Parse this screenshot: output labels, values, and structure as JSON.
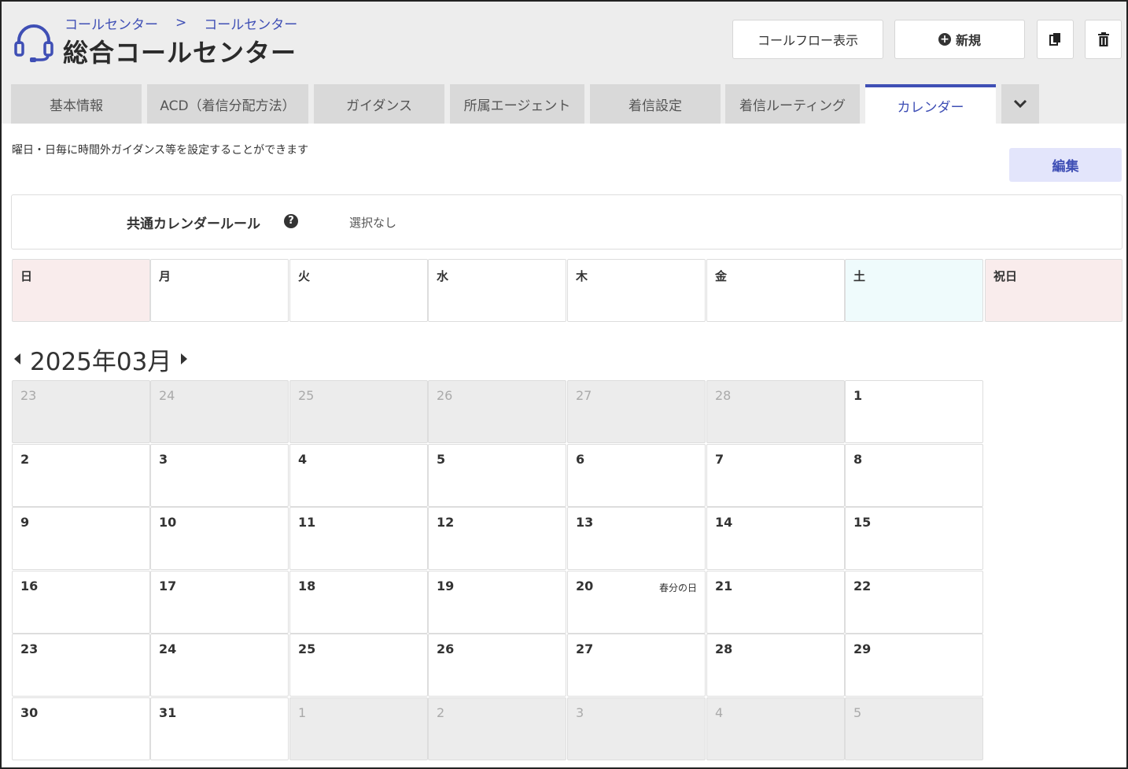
{
  "header": {
    "breadcrumb": [
      "コールセンター",
      "コールセンター"
    ],
    "breadcrumb_sep": ">",
    "title": "総合コールセンター",
    "buttons": {
      "flow_label": "コールフロー表示",
      "new_label": "新規",
      "new_icon": "+"
    }
  },
  "tabs": [
    {
      "label": "基本情報"
    },
    {
      "label": "ACD（着信分配方法）"
    },
    {
      "label": "ガイダンス"
    },
    {
      "label": "所属エージェント"
    },
    {
      "label": "着信設定"
    },
    {
      "label": "着信ルーティング"
    },
    {
      "label": "カレンダー",
      "active": true
    }
  ],
  "tab_more_icon": "⌄",
  "description": "曜日・日毎に時間外ガイダンス等を設定することができます",
  "edit_label": "編集",
  "rule": {
    "label": "共通カレンダールール",
    "help_icon": "?",
    "value": "選択なし"
  },
  "weekdays": [
    "日",
    "月",
    "火",
    "水",
    "木",
    "金",
    "土",
    "祝日"
  ],
  "month": {
    "label": "2025年03月",
    "prev_icon": "◀",
    "next_icon": "▶"
  },
  "calendar": {
    "weeks": [
      [
        {
          "d": "23",
          "out": true
        },
        {
          "d": "24",
          "out": true
        },
        {
          "d": "25",
          "out": true
        },
        {
          "d": "26",
          "out": true
        },
        {
          "d": "27",
          "out": true
        },
        {
          "d": "28",
          "out": true
        },
        {
          "d": "1"
        }
      ],
      [
        {
          "d": "2"
        },
        {
          "d": "3"
        },
        {
          "d": "4"
        },
        {
          "d": "5"
        },
        {
          "d": "6"
        },
        {
          "d": "7"
        },
        {
          "d": "8"
        }
      ],
      [
        {
          "d": "9"
        },
        {
          "d": "10"
        },
        {
          "d": "11"
        },
        {
          "d": "12"
        },
        {
          "d": "13"
        },
        {
          "d": "14"
        },
        {
          "d": "15"
        }
      ],
      [
        {
          "d": "16"
        },
        {
          "d": "17"
        },
        {
          "d": "18"
        },
        {
          "d": "19"
        },
        {
          "d": "20",
          "holiday": "春分の日"
        },
        {
          "d": "21"
        },
        {
          "d": "22"
        }
      ],
      [
        {
          "d": "23"
        },
        {
          "d": "24"
        },
        {
          "d": "25"
        },
        {
          "d": "26"
        },
        {
          "d": "27"
        },
        {
          "d": "28"
        },
        {
          "d": "29"
        }
      ],
      [
        {
          "d": "30"
        },
        {
          "d": "31"
        },
        {
          "d": "1",
          "out": true
        },
        {
          "d": "2",
          "out": true
        },
        {
          "d": "3",
          "out": true
        },
        {
          "d": "4",
          "out": true
        },
        {
          "d": "5",
          "out": true
        }
      ]
    ]
  },
  "colors": {
    "accent": "#3f4fb5",
    "sunday_bg": "#f9ecec",
    "saturday_bg": "#effbfc",
    "out_of_month_bg": "#ececec"
  }
}
